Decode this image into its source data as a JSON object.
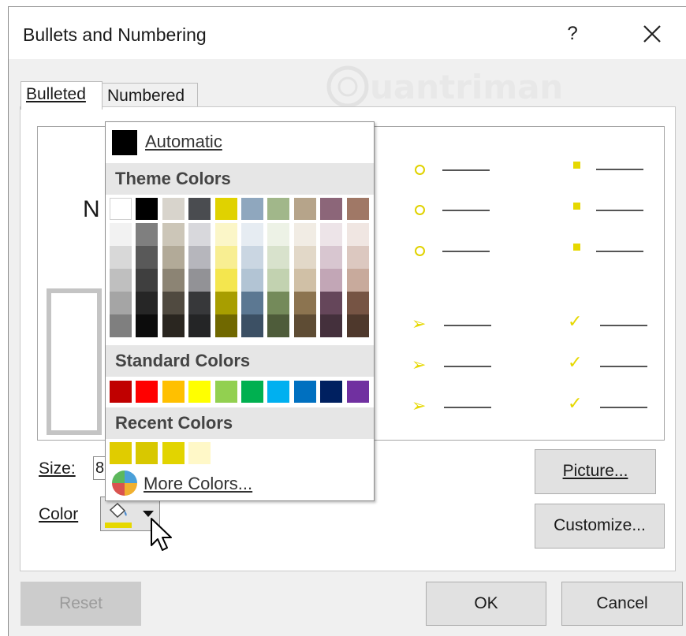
{
  "dialog": {
    "title": "Bullets and Numbering",
    "help_label": "?",
    "watermark_text": "uantrimang"
  },
  "tabs": [
    {
      "label": "Bulleted",
      "active": true
    },
    {
      "label": "Numbered",
      "active": false
    }
  ],
  "preview_letter": "N",
  "size": {
    "label": "Size:",
    "value": "8"
  },
  "color": {
    "label": "Color",
    "current": "#e6d800"
  },
  "buttons": {
    "picture": "Picture...",
    "customize": "Customize...",
    "reset": "Reset",
    "ok": "OK",
    "cancel": "Cancel"
  },
  "color_menu": {
    "automatic": "Automatic",
    "theme_header": "Theme Colors",
    "theme_colors": [
      [
        "#ffffff",
        "#000000",
        "#d8d4cc",
        "#4a4c50",
        "#e0d200",
        "#8fa7be",
        "#a1b78a",
        "#b6a48a",
        "#8c6679",
        "#a07866"
      ],
      [
        "#f2f2f2",
        "#7f7f7f",
        "#ccc6b8",
        "#d8d8dc",
        "#fbf6c8",
        "#e6ecf2",
        "#edf2e6",
        "#f1ece4",
        "#ede4e8",
        "#f0e6e2"
      ],
      [
        "#d8d8d8",
        "#595959",
        "#b2aa98",
        "#b6b6bc",
        "#f8ee92",
        "#cad6e2",
        "#d8e2cc",
        "#e2d8c8",
        "#d8c6d0",
        "#dcc8c0"
      ],
      [
        "#bfbfbf",
        "#3f3f3f",
        "#8c8474",
        "#929296",
        "#f4e64e",
        "#b2c4d4",
        "#c2d2b0",
        "#d0c0a6",
        "#c2a6b6",
        "#c8aa9c"
      ],
      [
        "#a5a5a5",
        "#262626",
        "#504a40",
        "#37383a",
        "#a89e00",
        "#5c7892",
        "#748a5a",
        "#8c7450",
        "#65465a",
        "#765444"
      ],
      [
        "#7f7f7f",
        "#0c0c0c",
        "#2a2620",
        "#242526",
        "#706800",
        "#3c5064",
        "#4e5c3a",
        "#5e4c34",
        "#44303c",
        "#4e382c"
      ]
    ],
    "standard_header": "Standard Colors",
    "standard_colors": [
      "#c00000",
      "#ff0000",
      "#ffc000",
      "#ffff00",
      "#92d050",
      "#00b050",
      "#00b0f0",
      "#0070c0",
      "#002060",
      "#7030a0"
    ],
    "recent_header": "Recent Colors",
    "recent_colors": [
      "#e0cc00",
      "#d8c800",
      "#e2d400",
      "#fff8c8"
    ],
    "more_colors": "More Colors..."
  }
}
